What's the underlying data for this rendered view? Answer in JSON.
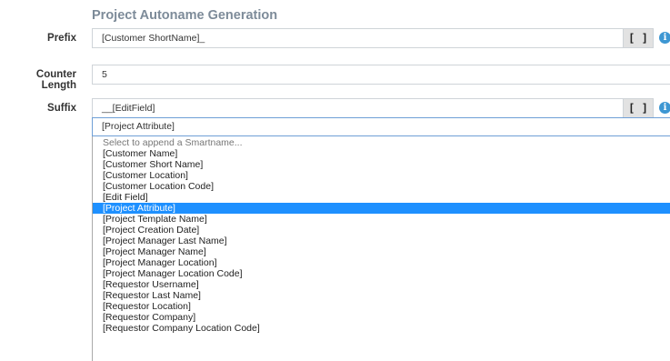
{
  "section_title": "Project Autoname Generation",
  "prefix": {
    "label": "Prefix",
    "value": "[Customer ShortName]_",
    "button_label": "[ ]",
    "info": "i"
  },
  "counter_length": {
    "label": "Counter Length",
    "value": "5"
  },
  "suffix": {
    "label": "Suffix",
    "value": "__[EditField]",
    "button_label": "[ ]",
    "info": "i"
  },
  "smartname_select": {
    "selected": "[Project Attribute]",
    "options": [
      "Select to append a Smartname...",
      "[Customer Name]",
      "[Customer Short Name]",
      "[Customer Location]",
      "[Customer Location Code]",
      "[Edit Field]",
      "[Project Attribute]",
      "[Project Template Name]",
      "[Project Creation Date]",
      "[Project Manager Last Name]",
      "[Project Manager Name]",
      "[Project Manager Location]",
      "[Project Manager Location Code]",
      "[Requestor Username]",
      "[Requestor Last Name]",
      "[Requestor Location]",
      "[Requestor Company]",
      "[Requestor Company Location Code]"
    ]
  },
  "colors": {
    "accent": "#1e90ff",
    "info": "#3d97d3",
    "title": "#7d8b99"
  }
}
